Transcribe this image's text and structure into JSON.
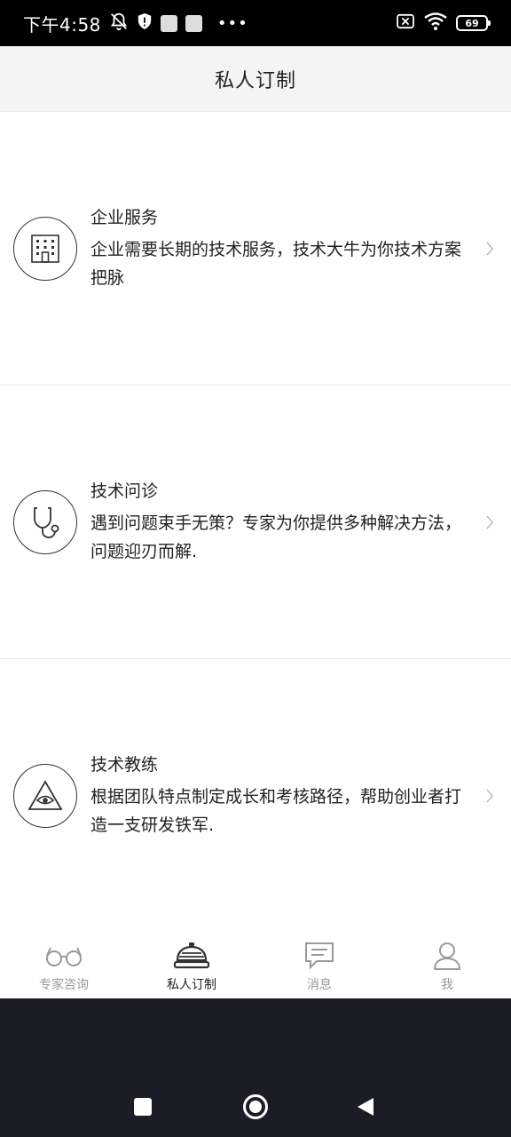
{
  "status_bar": {
    "time": "下午4:58",
    "battery": "69",
    "icons": [
      "mute-bell-icon",
      "shield-icon",
      "notification-square-icon",
      "notification-square-icon",
      "more-dots-icon",
      "sim-off-icon",
      "wifi-icon",
      "battery-icon"
    ]
  },
  "header": {
    "title": "私人订制"
  },
  "services": [
    {
      "name": "企业服务",
      "description": "企业需要长期的技术服务，技术大牛为你技术方案把脉",
      "icon": "building-icon"
    },
    {
      "name": "技术问诊",
      "description": "遇到问题束手无策？专家为你提供多种解决方法，问题迎刃而解.",
      "icon": "stethoscope-icon"
    },
    {
      "name": "技术教练",
      "description": "根据团队特点制定成长和考核路径，帮助创业者打造一支研发铁军.",
      "icon": "eye-triangle-icon"
    }
  ],
  "tabs": [
    {
      "label": "专家咨询",
      "icon": "glasses-icon",
      "active": false
    },
    {
      "label": "私人订制",
      "icon": "service-bell-icon",
      "active": true
    },
    {
      "label": "消息",
      "icon": "message-icon",
      "active": false
    },
    {
      "label": "我",
      "icon": "person-icon",
      "active": false
    }
  ],
  "colors": {
    "text": "#222222",
    "inactive": "#999999",
    "header_bg": "#f4f4f4",
    "nav_bg": "#1c1c26"
  }
}
